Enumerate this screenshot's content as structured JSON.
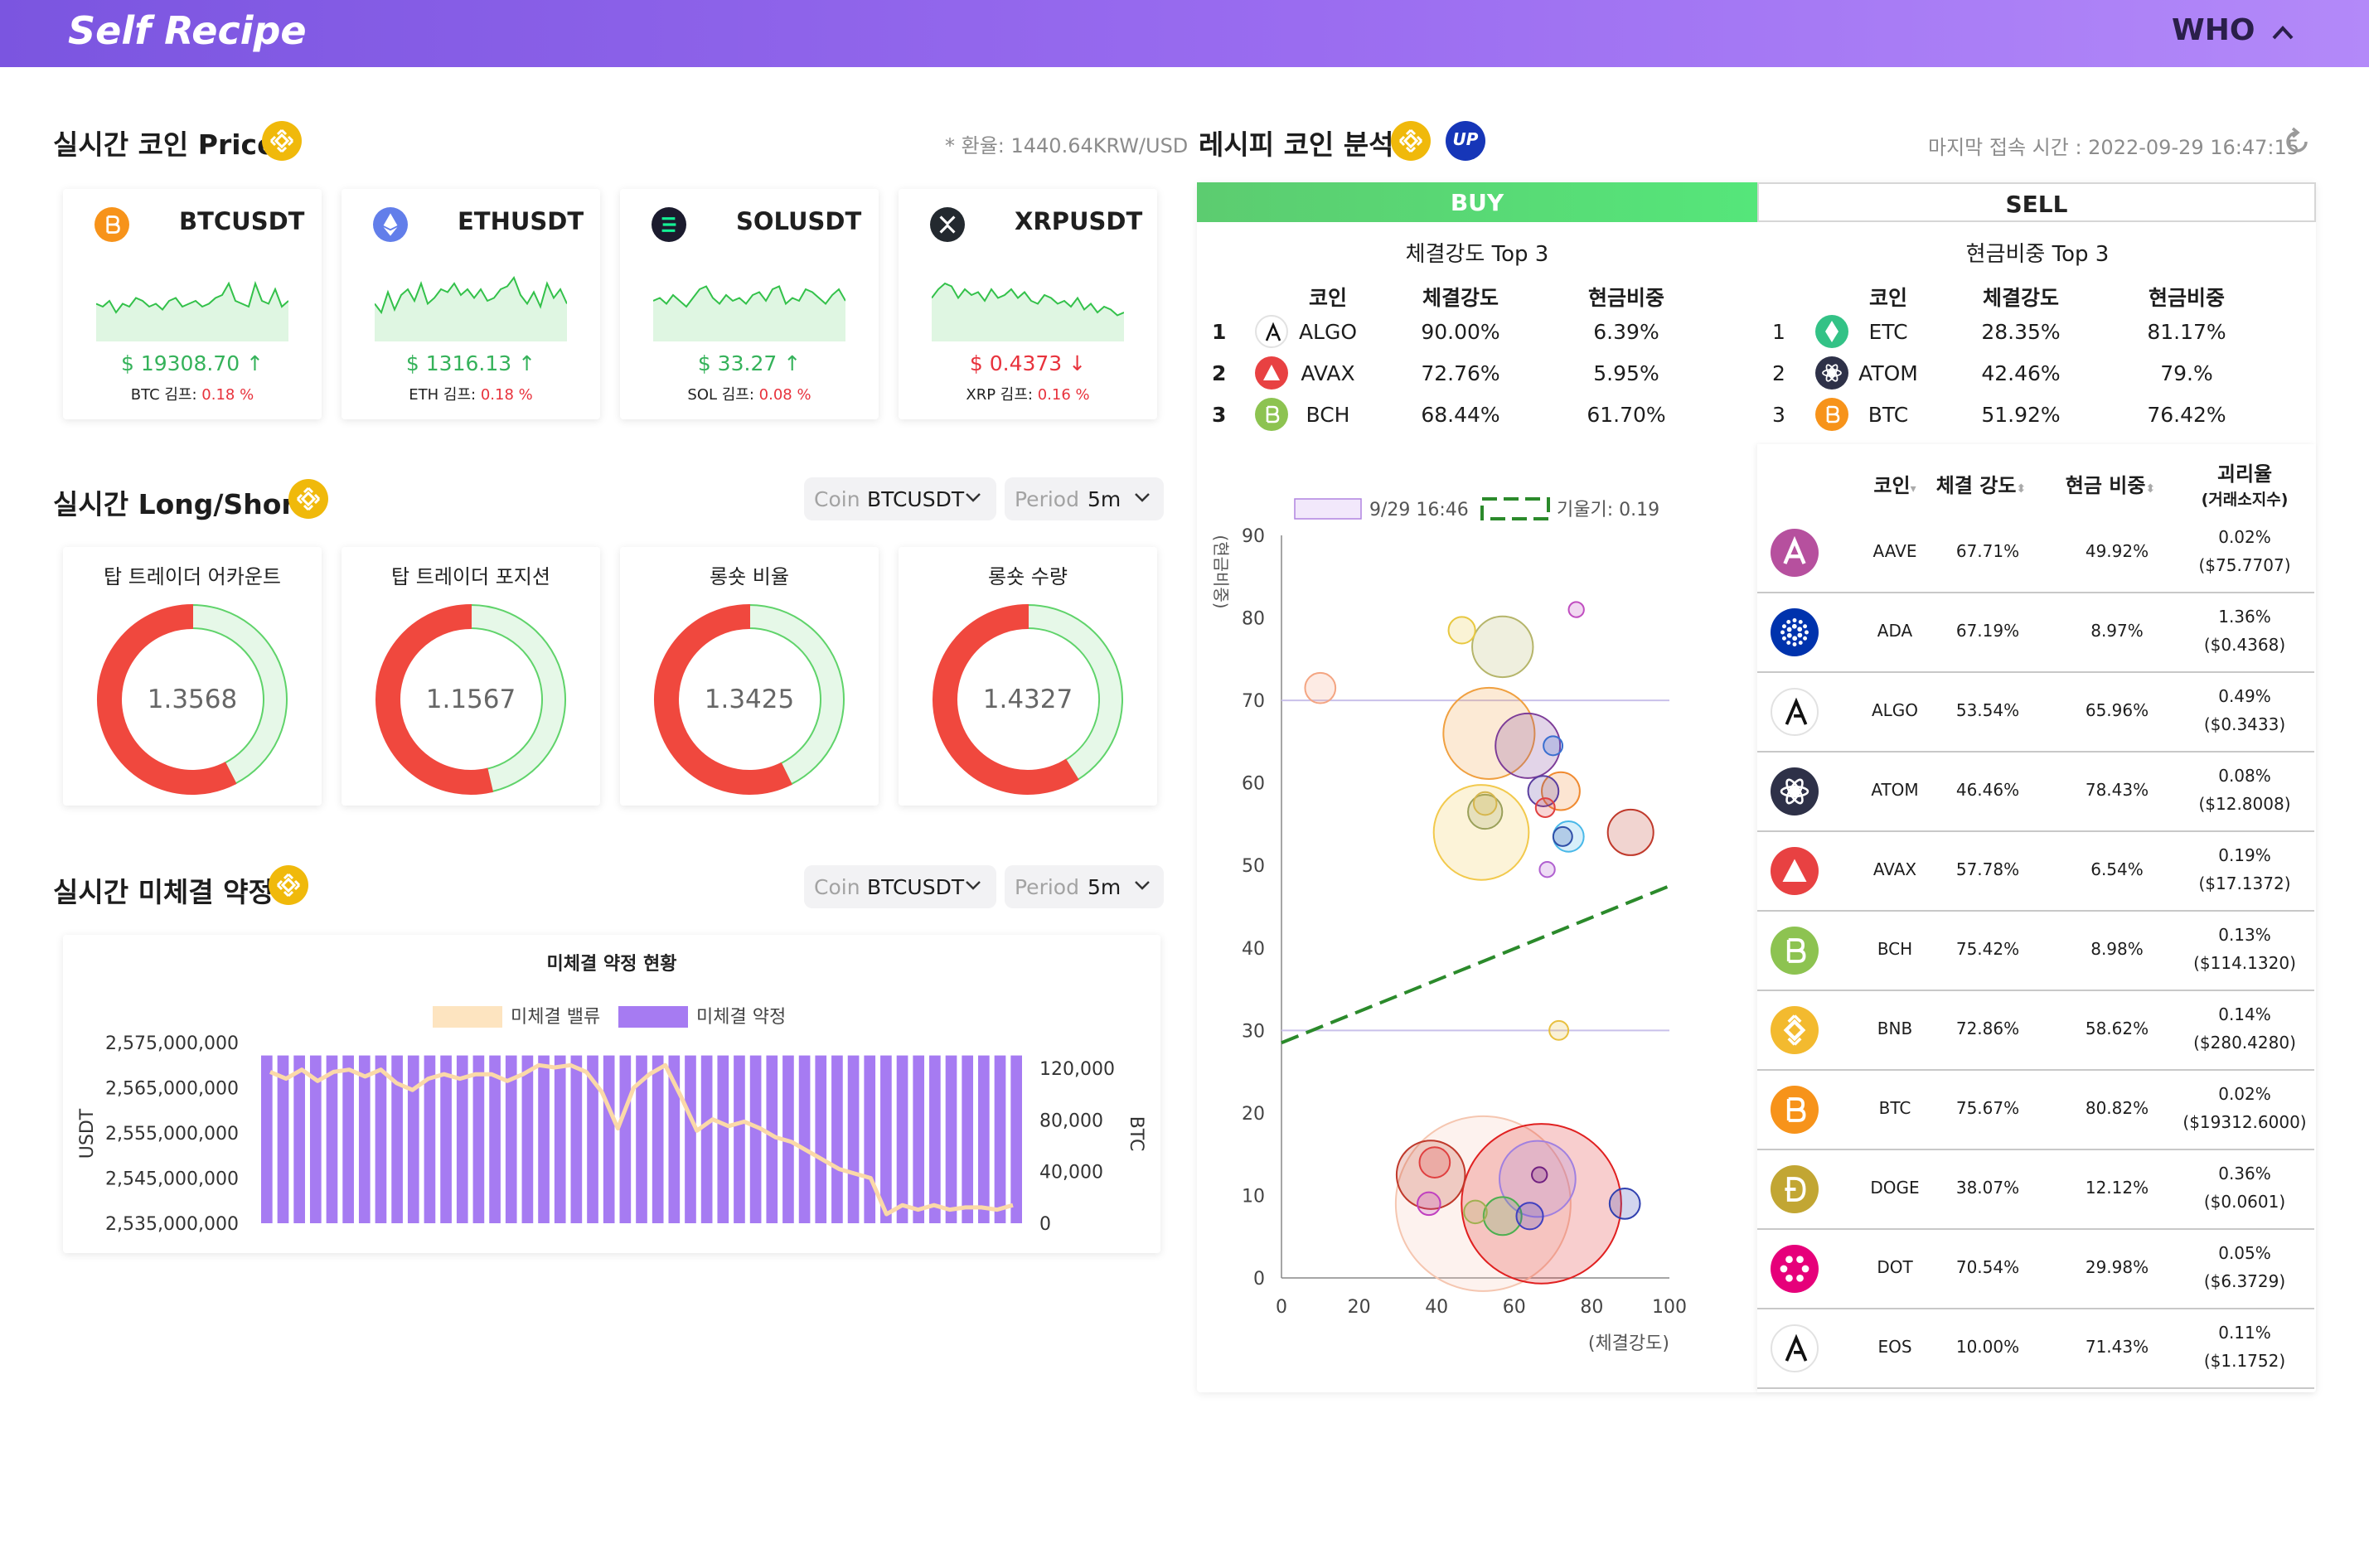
{
  "app": {
    "logo": "Self Recipe",
    "user": "WHO"
  },
  "realtime_price": {
    "title": "실시간 코인 Price",
    "fx_note": "* 환율: 1440.64KRW/USD",
    "cards": [
      {
        "symbol": "BTCUSDT",
        "price": "$ 19308.70 ↑",
        "kimp_label": "BTC 김프:",
        "kimp": "0.18 %",
        "trend": "up",
        "icon": "bitcoin-icon",
        "color": "#f7931a"
      },
      {
        "symbol": "ETHUSDT",
        "price": "$ 1316.13 ↑",
        "kimp_label": "ETH 김프:",
        "kimp": "0.18 %",
        "trend": "up",
        "icon": "ethereum-icon",
        "color": "#627eea"
      },
      {
        "symbol": "SOLUSDT",
        "price": "$ 33.27 ↑",
        "kimp_label": "SOL 김프:",
        "kimp": "0.08 %",
        "trend": "up",
        "icon": "solana-icon",
        "color": "#1b1b2e"
      },
      {
        "symbol": "XRPUSDT",
        "price": "$ 0.4373 ↓",
        "kimp_label": "XRP 김프:",
        "kimp": "0.16 %",
        "trend": "down",
        "icon": "xrp-icon",
        "color": "#23292f"
      }
    ]
  },
  "long_short": {
    "title": "실시간 Long/Short",
    "coin_label": "Coin",
    "coin_value": "BTCUSDT",
    "period_label": "Period",
    "period_value": "5m",
    "charts": [
      {
        "title": "탑 트레이더 어카운트",
        "value": "1.3568",
        "long_ratio": 0.5757
      },
      {
        "title": "탑 트레이더 포지션",
        "value": "1.1567",
        "long_ratio": 0.5364
      },
      {
        "title": "롱숏 비율",
        "value": "1.3425",
        "long_ratio": 0.5731
      },
      {
        "title": "롱숏 수량",
        "value": "1.4327",
        "long_ratio": 0.5889
      }
    ]
  },
  "open_interest": {
    "title": "실시간 미체결 약정",
    "coin_label": "Coin",
    "coin_value": "BTCUSDT",
    "period_label": "Period",
    "period_value": "5m"
  },
  "recipe": {
    "title": "레시피 코인 분석",
    "last_access": "마지막 접속 시간 : 2022-09-29 16:47:15",
    "tab_buy": "BUY",
    "tab_sell": "SELL",
    "buy": {
      "title": "체결강도 Top 3",
      "headers": [
        "코인",
        "체결강도",
        "현금비중"
      ],
      "rows": [
        {
          "rank": "1",
          "coin": "ALGO",
          "strength": "90.00%",
          "cash": "6.39%",
          "icon": "algorand-icon",
          "color": "#111111"
        },
        {
          "rank": "2",
          "coin": "AVAX",
          "strength": "72.76%",
          "cash": "5.95%",
          "icon": "avalanche-icon",
          "color": "#e84142"
        },
        {
          "rank": "3",
          "coin": "BCH",
          "strength": "68.44%",
          "cash": "61.70%",
          "icon": "bitcoin-cash-icon",
          "color": "#8dc351"
        }
      ]
    },
    "sell": {
      "title": "현금비중 Top 3",
      "headers": [
        "코인",
        "체결강도",
        "현금비중"
      ],
      "rows": [
        {
          "rank": "1",
          "coin": "ETC",
          "strength": "28.35%",
          "cash": "81.17%",
          "icon": "ethereum-classic-icon",
          "color": "#33c286"
        },
        {
          "rank": "2",
          "coin": "ATOM",
          "strength": "42.46%",
          "cash": "79.%",
          "icon": "cosmos-icon",
          "color": "#2e3148"
        },
        {
          "rank": "3",
          "coin": "BTC",
          "strength": "51.92%",
          "cash": "76.42%",
          "icon": "bitcoin-icon",
          "color": "#f7931a"
        }
      ]
    },
    "list_headers": {
      "coin": "코인",
      "strength": "체결 강도",
      "cash": "현금 비중",
      "gap": "괴리율",
      "gap_sub": "(거래소지수)"
    },
    "list": [
      {
        "coin": "AAVE",
        "strength": "67.71%",
        "cash": "49.92%",
        "gap": "0.02%",
        "gap_price": "($75.7707)",
        "icon": "aave-icon",
        "color": "#b6509e"
      },
      {
        "coin": "ADA",
        "strength": "67.19%",
        "cash": "8.97%",
        "gap": "1.36%",
        "gap_price": "($0.4368)",
        "icon": "cardano-icon",
        "color": "#0033ad"
      },
      {
        "coin": "ALGO",
        "strength": "53.54%",
        "cash": "65.96%",
        "gap": "0.49%",
        "gap_price": "($0.3433)",
        "icon": "algorand-icon",
        "color": "#ffffff"
      },
      {
        "coin": "ATOM",
        "strength": "46.46%",
        "cash": "78.43%",
        "gap": "0.08%",
        "gap_price": "($12.8008)",
        "icon": "cosmos-icon",
        "color": "#2e3148"
      },
      {
        "coin": "AVAX",
        "strength": "57.78%",
        "cash": "6.54%",
        "gap": "0.19%",
        "gap_price": "($17.1372)",
        "icon": "avalanche-icon",
        "color": "#e84142"
      },
      {
        "coin": "BCH",
        "strength": "75.42%",
        "cash": "8.98%",
        "gap": "0.13%",
        "gap_price": "($114.1320)",
        "icon": "bitcoin-cash-icon",
        "color": "#8dc351"
      },
      {
        "coin": "BNB",
        "strength": "72.86%",
        "cash": "58.62%",
        "gap": "0.14%",
        "gap_price": "($280.4280)",
        "icon": "bnb-icon",
        "color": "#f3ba2f"
      },
      {
        "coin": "BTC",
        "strength": "75.67%",
        "cash": "80.82%",
        "gap": "0.02%",
        "gap_price": "($19312.6000)",
        "icon": "bitcoin-icon",
        "color": "#f7931a"
      },
      {
        "coin": "DOGE",
        "strength": "38.07%",
        "cash": "12.12%",
        "gap": "0.36%",
        "gap_price": "($0.0601)",
        "icon": "dogecoin-icon",
        "color": "#c2a633"
      },
      {
        "coin": "DOT",
        "strength": "70.54%",
        "cash": "29.98%",
        "gap": "0.05%",
        "gap_price": "($6.3729)",
        "icon": "polkadot-icon",
        "color": "#e6007a"
      },
      {
        "coin": "EOS",
        "strength": "10.00%",
        "cash": "71.43%",
        "gap": "0.11%",
        "gap_price": "($1.1752)",
        "icon": "eos-icon",
        "color": "#ffffff"
      }
    ]
  },
  "chart_data": [
    {
      "type": "bar",
      "title": "미체결 약정 현황",
      "legend": [
        "미체결 밸류",
        "미체결 약정"
      ],
      "ylabel": "USDT",
      "y2label": "BTC",
      "yticks": [
        "2,575,000,000",
        "2,565,000,000",
        "2,555,000,000",
        "2,545,000,000",
        "2,535,000,000"
      ],
      "y2ticks": [
        "120,000",
        "80,000",
        "40,000",
        "0"
      ],
      "ylim": [
        2535000000,
        2575000000
      ],
      "y2lim": [
        0,
        140000
      ],
      "series": [
        {
          "name": "미체결 약정",
          "axis": "y2",
          "kind": "bar",
          "color": "#a67bf2",
          "values": [
            130000,
            130000,
            130000,
            130000,
            130000,
            130000,
            130000,
            130000,
            130000,
            130000,
            130000,
            130000,
            130000,
            130000,
            130000,
            130000,
            130000,
            130000,
            130000,
            130000,
            130000,
            130000,
            130000,
            130000,
            130000,
            130000,
            130000,
            130000,
            130000,
            130000,
            130000,
            130000,
            130000,
            130000,
            130000,
            130000,
            130000,
            130000,
            130000,
            130000,
            130000,
            130000,
            130000,
            130000,
            130000,
            130000,
            130000
          ]
        },
        {
          "name": "미체결 밸류",
          "axis": "y",
          "kind": "line",
          "color": "#fbd9a8",
          "values": [
            2568500000,
            2567000000,
            2569000000,
            2566500000,
            2568500000,
            2569000000,
            2567500000,
            2569000000,
            2566000000,
            2564500000,
            2567000000,
            2568000000,
            2567000000,
            2568000000,
            2568000000,
            2566500000,
            2568000000,
            2570000000,
            2569500000,
            2570000000,
            2568500000,
            2564000000,
            2556000000,
            2565000000,
            2568000000,
            2570000000,
            2563000000,
            2555500000,
            2558000000,
            2556500000,
            2557500000,
            2556000000,
            2554000000,
            2553000000,
            2551000000,
            2549000000,
            2547000000,
            2546000000,
            2545000000,
            2537000000,
            2539000000,
            2538000000,
            2539000000,
            2538000000,
            2538500000,
            2538500000,
            2538000000,
            2539000000
          ]
        }
      ]
    },
    {
      "type": "scatter",
      "xlabel": "(체결강도)",
      "ylabel": "(현금비중)",
      "xlim": [
        0,
        100
      ],
      "ylim": [
        0,
        90
      ],
      "xticks": [
        0,
        20,
        40,
        60,
        80,
        100
      ],
      "yticks": [
        0,
        10,
        20,
        30,
        40,
        50,
        60,
        70,
        80,
        90
      ],
      "hlines": [
        70,
        30
      ],
      "legend": [
        "9/29 16:46",
        "기울기: 0.19"
      ],
      "trendline": {
        "x": [
          0,
          100
        ],
        "y": [
          28.5,
          47.5
        ],
        "color": "#2b8a2b"
      },
      "points": [
        {
          "x": 10,
          "y": 71.5,
          "r": 4,
          "color": "#f4a582"
        },
        {
          "x": 46.5,
          "y": 78.5,
          "r": 3.5,
          "color": "#e8c840"
        },
        {
          "x": 57,
          "y": 76.5,
          "r": 8,
          "color": "#b5b56a"
        },
        {
          "x": 76,
          "y": 81,
          "r": 2,
          "color": "#c04dc0"
        },
        {
          "x": 53.5,
          "y": 66,
          "r": 12,
          "color": "#f0a040"
        },
        {
          "x": 63.5,
          "y": 64.5,
          "r": 8.5,
          "color": "#7d3c98"
        },
        {
          "x": 70,
          "y": 64.5,
          "r": 2.5,
          "color": "#3a6fd0"
        },
        {
          "x": 52.5,
          "y": 57.5,
          "r": 3,
          "color": "#d6b64d"
        },
        {
          "x": 52.5,
          "y": 56.5,
          "r": 4.5,
          "color": "#9aa05a"
        },
        {
          "x": 51.5,
          "y": 54,
          "r": 12.5,
          "color": "#f2c94c"
        },
        {
          "x": 67.5,
          "y": 59,
          "r": 4,
          "color": "#5a3ea0"
        },
        {
          "x": 72,
          "y": 59,
          "r": 5,
          "color": "#f08a30"
        },
        {
          "x": 68,
          "y": 57,
          "r": 2.5,
          "color": "#e04040"
        },
        {
          "x": 74,
          "y": 53.5,
          "r": 4,
          "color": "#48b8e8"
        },
        {
          "x": 72.5,
          "y": 53.5,
          "r": 2.5,
          "color": "#3050a8"
        },
        {
          "x": 90,
          "y": 54,
          "r": 6,
          "color": "#c0392b"
        },
        {
          "x": 68.5,
          "y": 49.5,
          "r": 2,
          "color": "#b060d0"
        },
        {
          "x": 71.5,
          "y": 30,
          "r": 2.5,
          "color": "#e8c040"
        },
        {
          "x": 38.5,
          "y": 12.5,
          "r": 9,
          "color": "#c0392b"
        },
        {
          "x": 39.5,
          "y": 14,
          "r": 4,
          "color": "#e04040"
        },
        {
          "x": 52,
          "y": 9,
          "r": 23,
          "color": "#f5c6b0"
        },
        {
          "x": 67,
          "y": 9,
          "r": 21,
          "color": "#e02020"
        },
        {
          "x": 66,
          "y": 12,
          "r": 10,
          "color": "#a080e0"
        },
        {
          "x": 66.5,
          "y": 12.5,
          "r": 2,
          "color": "#702080"
        },
        {
          "x": 57,
          "y": 7.5,
          "r": 5,
          "color": "#4caf50"
        },
        {
          "x": 64,
          "y": 7.5,
          "r": 3.5,
          "color": "#4040c0"
        },
        {
          "x": 50,
          "y": 8,
          "r": 3,
          "color": "#a0b050"
        },
        {
          "x": 38,
          "y": 9,
          "r": 3,
          "color": "#c040c0"
        },
        {
          "x": 88.5,
          "y": 9,
          "r": 4,
          "color": "#3040b0"
        }
      ]
    }
  ]
}
